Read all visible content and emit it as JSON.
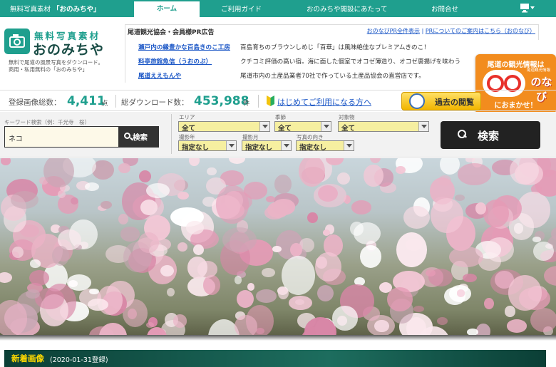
{
  "topnav": {
    "site_prefix": "無料写真素材",
    "site_name": "「おのみちや」",
    "items": [
      "ホーム",
      "ご利用ガイド",
      "おのみちや開設にあたって",
      "お問合せ"
    ]
  },
  "logo": {
    "sub": "無料写真素材",
    "main": "おのみちや",
    "desc_line1": "無料で尾道の風景写真をダウンロード。",
    "desc_line2": "商用・私用無料の「おのみちや」"
  },
  "pr": {
    "title": "尾道観光協会・会員様PR広告",
    "link_all": "おのなびPR全件表示",
    "link_inquiry": "PRについてのご案内はこちら（おのなび）",
    "rows": [
      {
        "name": "瀬戸内の縁豊かな百島きのこ工房",
        "desc": "百島育ちのブラウンしめじ「百華」は風味絶佳なプレミアムきのこ！"
      },
      {
        "name": "料亭旅館魚信（うおのぶ）",
        "desc": "クチコミ評価の高い宿。海に面した個室でオコゼ薄造り、オコゼ唐揚げを味わう"
      },
      {
        "name": "尾道ええもんや",
        "desc": "尾道市内の土産品業者70社で作っている土産品協会の直営店です。"
      }
    ]
  },
  "onavi": {
    "line1": "尾道の観光情報は",
    "mini": "尾道観光情報",
    "navi": "のなび",
    "line2": "におまかせ！"
  },
  "stats": {
    "images_label": "登録画像総数：",
    "images_value": "4,411",
    "images_unit": "点",
    "downloads_label": "総ダウンロード数：",
    "downloads_value": "453,988",
    "downloads_unit": "件",
    "beginner_link": "はじめてご利用になる方へ",
    "past_button": "過去の閲覧"
  },
  "search": {
    "keyword_label": "キーワード検索（例：千光寺　桜）",
    "keyword_value": "ネコ",
    "keyword_button": "検索",
    "area_label": "エリア",
    "area_value": "全て",
    "season_label": "季節",
    "season_value": "全て",
    "target_label": "対象物",
    "target_value": "全て",
    "year_label": "撮影年",
    "year_value": "指定なし",
    "month_label": "撮影月",
    "month_value": "指定なし",
    "orient_label": "写真の向き",
    "orient_value": "指定なし",
    "big_button": "検索"
  },
  "new_section": {
    "title": "新着画像",
    "date": "(2020-01-31登録)"
  },
  "colors": {
    "brand": "#1f9f8e",
    "link": "#1a56c6",
    "accent_orange": "#f28c1e",
    "select_bg": "#f6efa0"
  }
}
